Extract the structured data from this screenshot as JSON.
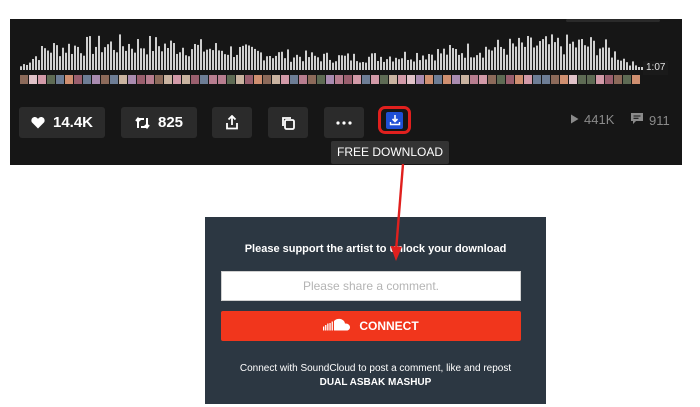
{
  "player": {
    "duration": "1:07",
    "actions": [
      {
        "name": "like-button",
        "icon": "heart-icon",
        "label": "14.4K"
      },
      {
        "name": "repost-button",
        "icon": "repost-icon",
        "label": "825"
      },
      {
        "name": "share-button",
        "icon": "share-icon",
        "label": ""
      },
      {
        "name": "copy-link-button",
        "icon": "copy-icon",
        "label": ""
      },
      {
        "name": "more-button",
        "icon": "more-icon",
        "label": ""
      }
    ],
    "download": {
      "icon": "download-icon",
      "tooltip": "FREE DOWNLOAD",
      "highlight_color": "#e0201e"
    },
    "stats": {
      "plays": "441K",
      "comments": "911"
    }
  },
  "gate": {
    "heading": "Please support the artist to unlock your download",
    "comment_placeholder": "Please share a comment.",
    "connect_label": "CONNECT",
    "connect_icon": "soundcloud-icon",
    "note_prefix": "Connect with SoundCloud to post a comment, like and repost",
    "track_name": "DUAL ASBAK MASHUP"
  },
  "colors": {
    "player_bg": "#161616",
    "panel_bg": "#2c3742",
    "accent": "#f1361c",
    "annotation": "#e0201e"
  }
}
